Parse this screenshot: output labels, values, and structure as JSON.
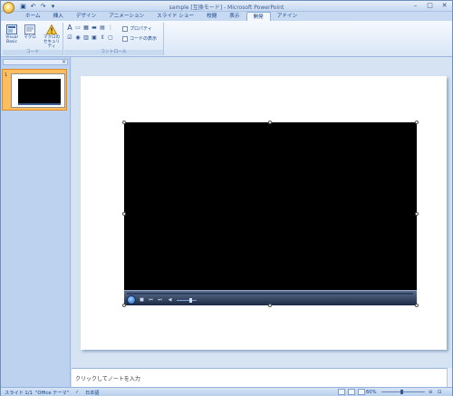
{
  "app": {
    "title": "sample [互換モード] - Microsoft PowerPoint"
  },
  "qat": {
    "save_icon": "save-icon",
    "undo_icon": "undo-icon",
    "redo_icon": "redo-icon",
    "customize_icon": "chevron-down-icon"
  },
  "window_controls": {
    "minimize": "–",
    "maximize": "□",
    "close": "✕"
  },
  "tabs": [
    {
      "label": "ホーム"
    },
    {
      "label": "挿入"
    },
    {
      "label": "デザイン"
    },
    {
      "label": "アニメーション"
    },
    {
      "label": "スライド ショー"
    },
    {
      "label": "校閲"
    },
    {
      "label": "表示"
    },
    {
      "label": "開発"
    },
    {
      "label": "アドイン"
    }
  ],
  "active_tab": "開発",
  "ribbon": {
    "code_group": {
      "label": "コード",
      "vba_label_1": "Visual",
      "vba_label_2": "Basic",
      "macro_label": "マクロ",
      "security_label_1": "マクロの",
      "security_label_2": "セキュリティ"
    },
    "controls_group": {
      "label": "コントロール",
      "properties_label": "プロパティ",
      "view_code_label": "コードの表示"
    }
  },
  "left_pane": {
    "slide_number": "1"
  },
  "slide": {
    "video": {
      "type": "windows-media-player",
      "play_icon": "play-icon",
      "stop_icon": "stop-icon",
      "prev_icon": "previous-icon",
      "next_icon": "next-icon",
      "volume_icon": "volume-icon"
    }
  },
  "notes": {
    "placeholder": "クリックしてノートを入力"
  },
  "status_bar": {
    "slide_info": "スライド 1/1",
    "theme": "\"Office テーマ\"",
    "language": "日本語",
    "zoom": "60%"
  },
  "colors": {
    "ribbon_bg": "#d9e6f6",
    "active_tab": "#f3f7fc",
    "selection": "#fdbe5f",
    "slide_bg": "#ffffff",
    "video_bg": "#000000"
  }
}
